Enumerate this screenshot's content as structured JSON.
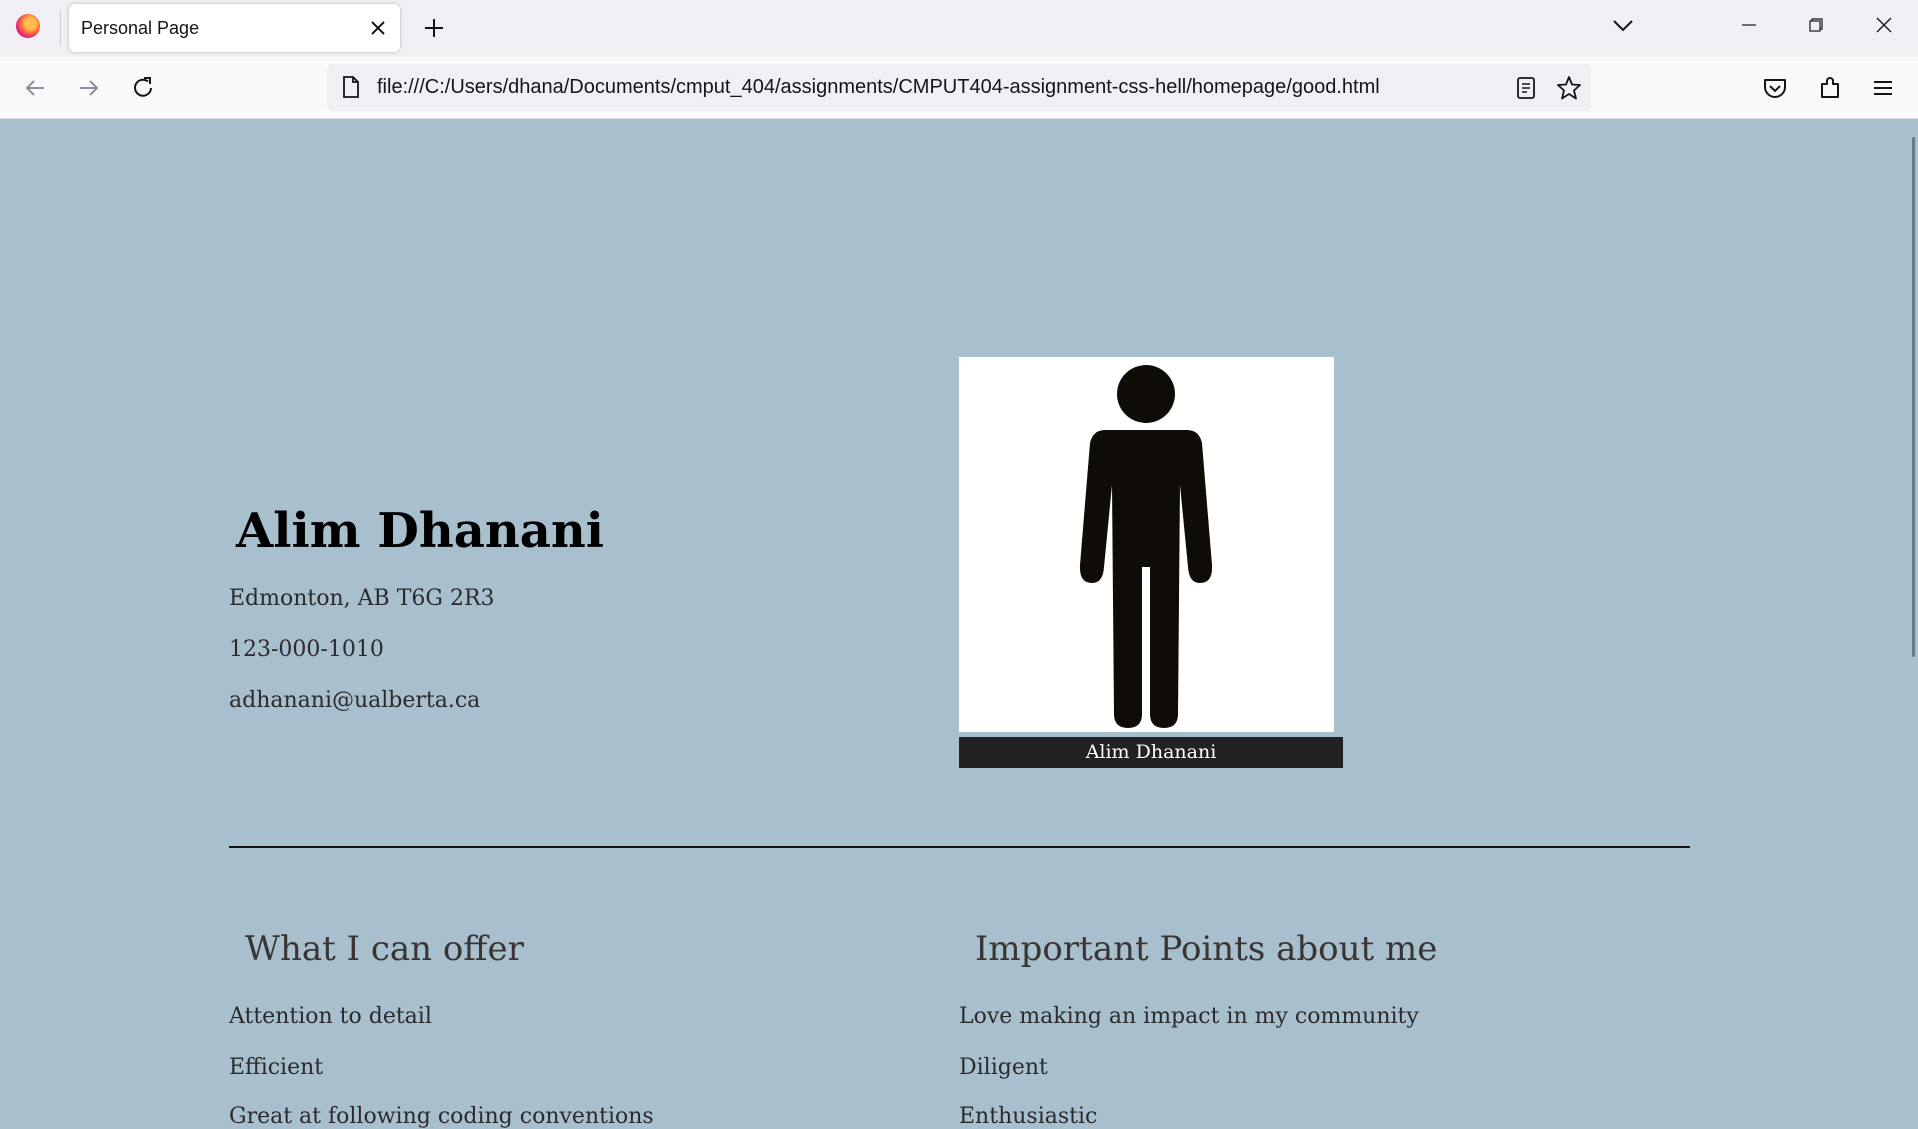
{
  "browser": {
    "tab_title": "Personal Page",
    "url": "file:///C:/Users/dhana/Documents/cmput_404/assignments/CMPUT404-assignment-css-hell/homepage/good.html",
    "icons": [
      "firefox-logo",
      "close-icon",
      "plus-icon",
      "chevron-down-icon",
      "minimize-icon",
      "restore-icon",
      "close-window-icon",
      "back-arrow-icon",
      "forward-arrow-icon",
      "reload-icon",
      "page-icon",
      "reader-view-icon",
      "star-icon",
      "pocket-icon",
      "extensions-icon",
      "hamburger-menu-icon"
    ]
  },
  "profile": {
    "name": "Alim Dhanani",
    "address": "Edmonton, AB T6G 2R3",
    "phone": "123-000-1010",
    "email": "adhanani@ualberta.ca",
    "photo_caption": "Alim Dhanani"
  },
  "offer": {
    "heading": "What I can offer",
    "items": [
      "Attention to detail",
      "Efficient",
      "Great at following coding conventions"
    ]
  },
  "points": {
    "heading": "Important Points about me",
    "items": [
      "Love making an impact in my community",
      "Diligent",
      "Enthusiastic"
    ]
  },
  "colors": {
    "page_background": "#a8bfcd",
    "caption_background": "#222222"
  }
}
